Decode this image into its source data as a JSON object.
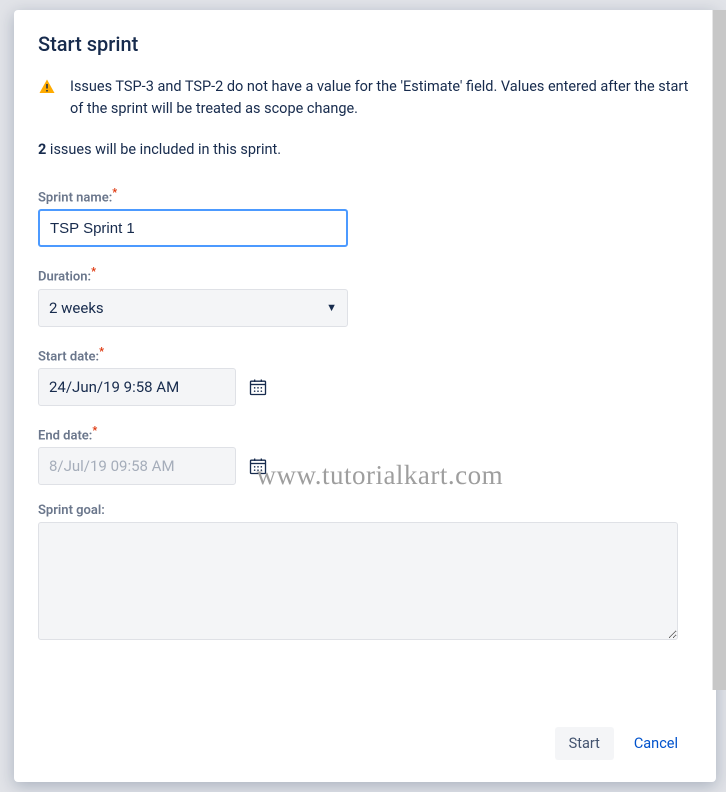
{
  "modal": {
    "title": "Start sprint",
    "warning": "Issues TSP-3 and TSP-2 do not have a value for the 'Estimate' field. Values entered after the start of the sprint will be treated as scope change.",
    "issueCount": "2",
    "issueCountSuffix": " issues will be included in this sprint."
  },
  "fields": {
    "sprintName": {
      "label": "Sprint name:",
      "value": "TSP Sprint 1"
    },
    "duration": {
      "label": "Duration:",
      "value": "2 weeks"
    },
    "startDate": {
      "label": "Start date:",
      "value": "24/Jun/19 9:58 AM"
    },
    "endDate": {
      "label": "End date:",
      "value": "8/Jul/19 09:58 AM"
    },
    "sprintGoal": {
      "label": "Sprint goal:",
      "value": ""
    }
  },
  "footer": {
    "start": "Start",
    "cancel": "Cancel"
  },
  "watermark": "www.tutorialkart.com"
}
